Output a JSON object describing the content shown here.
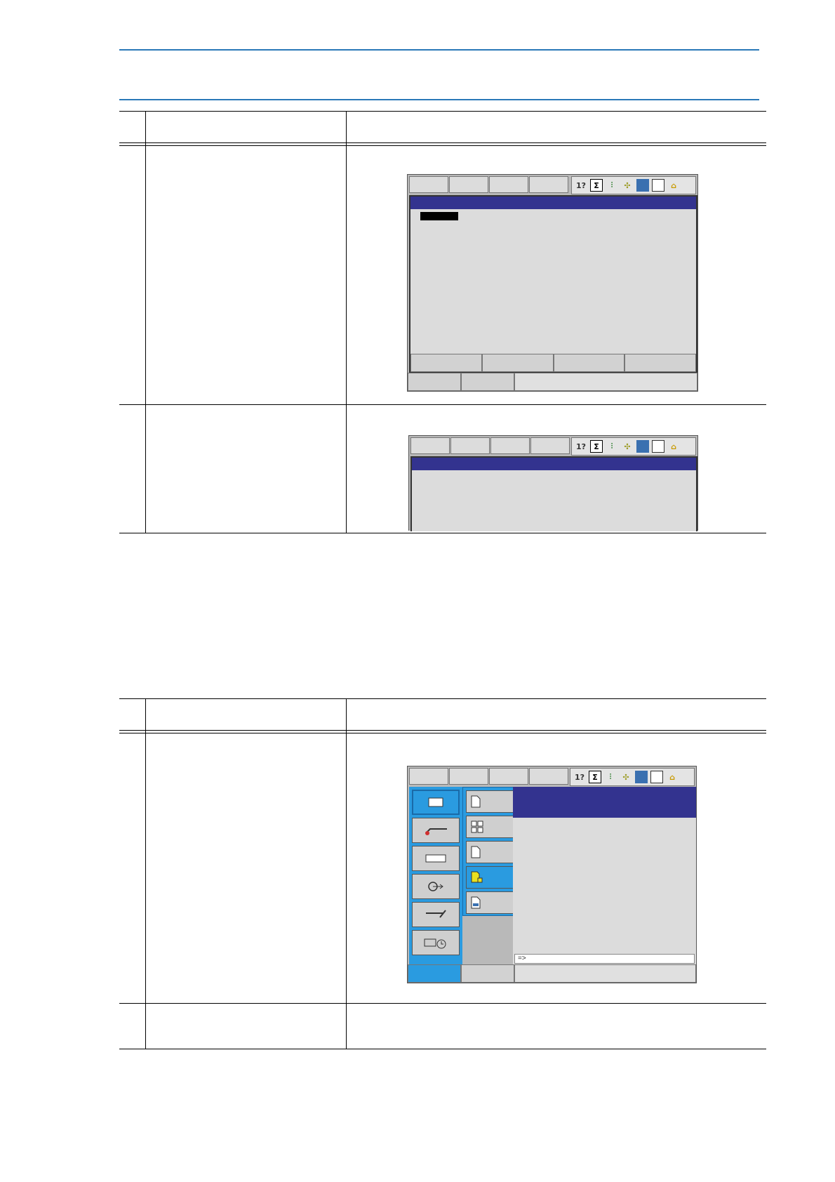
{
  "screen1": {
    "status_icons": [
      "io-icon",
      "sigma-icon",
      "tool-icon",
      "robot-icon",
      "grid-icon",
      "edit-icon",
      "lock-icon"
    ]
  },
  "screen2": {
    "status_icons": [
      "io-icon",
      "sigma-icon",
      "tool-icon",
      "robot-icon",
      "grid-icon",
      "edit-icon",
      "lock-icon"
    ]
  },
  "screen3": {
    "status_icons": [
      "io-icon",
      "sigma-icon",
      "tool-icon",
      "robot-icon",
      "grid-icon",
      "edit-icon",
      "lock-icon"
    ],
    "main_menu_icons": [
      "job-icon",
      "arc-welding-icon",
      "variable-icon",
      "in-out-icon",
      "robot-icon",
      "system-info-icon"
    ],
    "sub_menu_icons": [
      "job-file-icon",
      "select-job-icon",
      "create-job-icon",
      "master-job-icon",
      "job-capacity-icon"
    ],
    "input_prompt": "=>"
  }
}
